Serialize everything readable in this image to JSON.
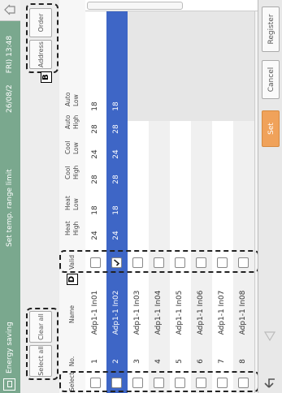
{
  "title_bar": {
    "app_name": "Energy saving",
    "screen_title": "Set temp. range limit",
    "datetime": "26/08/2",
    "datetime_suffix": "FRI) 13:48"
  },
  "toolbar": {
    "select_all": "Select all",
    "clear_all": "Clear all",
    "address": "Address",
    "order": "Order"
  },
  "markers": {
    "b": "B",
    "d": "D"
  },
  "columns": {
    "select": "Select",
    "no": "No.",
    "name": "Name",
    "valid": "Valid",
    "heat_high": [
      "Heat",
      "High"
    ],
    "heat_low": [
      "Heat",
      "Low"
    ],
    "cool_high": [
      "Cool",
      "High"
    ],
    "cool_low": [
      "Cool",
      "Low"
    ],
    "auto_high": [
      "Auto",
      "High"
    ],
    "auto_low": [
      "Auto",
      "Low"
    ]
  },
  "rows": [
    {
      "no": "1",
      "name": "Adp1-1 In01",
      "heat_high": "24",
      "heat_low": "18",
      "cool_high": "28",
      "cool_low": "24",
      "auto_high": "28",
      "auto_low": "18",
      "valid": false,
      "selected": false
    },
    {
      "no": "2",
      "name": "Adp1-1 In02",
      "heat_high": "24",
      "heat_low": "18",
      "cool_high": "28",
      "cool_low": "24",
      "auto_high": "28",
      "auto_low": "18",
      "valid": true,
      "selected": true
    },
    {
      "no": "3",
      "name": "Adp1-1 In03",
      "valid": false,
      "selected": false
    },
    {
      "no": "4",
      "name": "Adp1-1 In04",
      "valid": false,
      "selected": false
    },
    {
      "no": "5",
      "name": "Adp1-1 In05",
      "valid": false,
      "selected": false
    },
    {
      "no": "6",
      "name": "Adp1-1 In06",
      "valid": false,
      "selected": false
    },
    {
      "no": "7",
      "name": "Adp1-1 In07",
      "valid": false,
      "selected": false
    },
    {
      "no": "8",
      "name": "Adp1-1 In08",
      "valid": false,
      "selected": false
    }
  ],
  "bottom": {
    "set": "Set",
    "cancel": "Cancel",
    "register": "Register"
  },
  "colors": {
    "title_bar": "#7aa88e",
    "selected_row": "#3e66c6",
    "set_button": "#f0a25a"
  }
}
